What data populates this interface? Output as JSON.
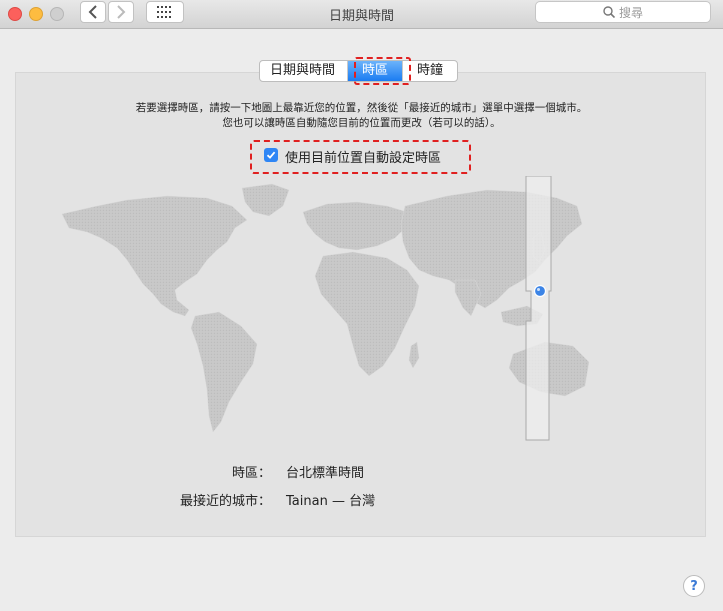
{
  "window": {
    "title": "日期與時間"
  },
  "search": {
    "placeholder": "搜尋"
  },
  "tabs": [
    {
      "label": "日期與時間"
    },
    {
      "label": "時區",
      "selected": true
    },
    {
      "label": "時鐘"
    }
  ],
  "instructions": {
    "line1": "若要選擇時區，請按一下地圖上最靠近您的位置，然後從「最接近的城市」選單中選擇一個城市。",
    "line2": "您也可以讓時區自動隨您目前的位置而更改（若可以的話）。"
  },
  "auto_timezone": {
    "label": "使用目前位置自動設定時區",
    "checked": true
  },
  "timezone": {
    "label": "時區：",
    "value": "台北標準時間"
  },
  "closest_city": {
    "label": "最接近的城市：",
    "value": "Tainan — 台灣"
  },
  "help": {
    "label": "?"
  },
  "colors": {
    "accent": "#2f86f5",
    "highlight": "#e02020"
  }
}
